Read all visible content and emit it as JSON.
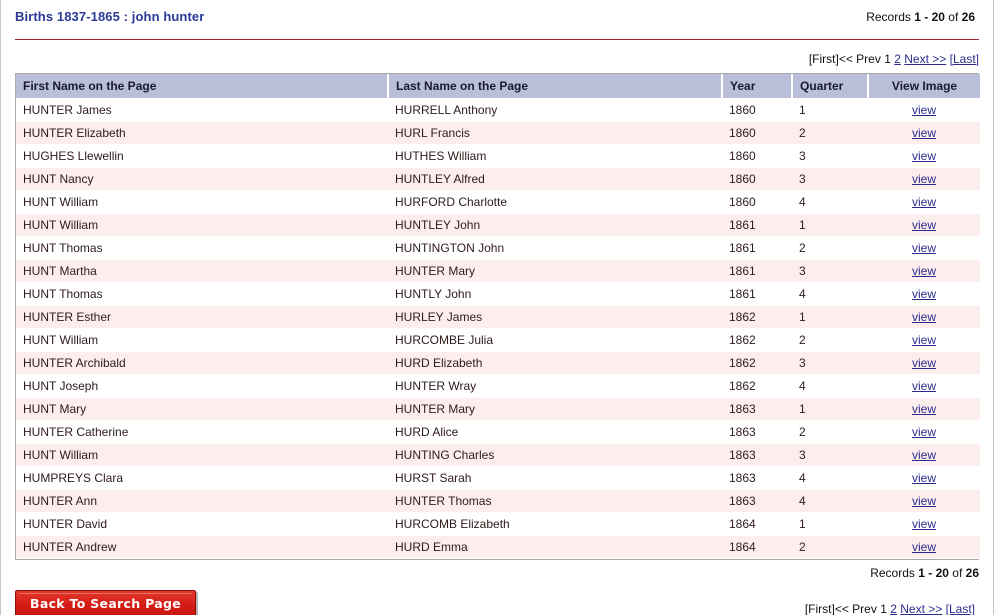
{
  "header": {
    "title": "Births 1837-1865 : john hunter",
    "records_prefix": "Records",
    "records_range": "1 - 20",
    "records_of": "of",
    "records_total": "26"
  },
  "pager": {
    "first": "[First]",
    "prev": "<< Prev",
    "page_current": "1",
    "page_next_num": "2",
    "next": "Next >>",
    "last": "[Last]"
  },
  "table": {
    "columns": [
      "First Name on the Page",
      "Last Name on the Page",
      "Year",
      "Quarter",
      "View Image"
    ],
    "view_link_label": "view",
    "rows": [
      {
        "first": "HUNTER James",
        "last": "HURRELL Anthony",
        "year": "1860",
        "quarter": "1",
        "view": "view"
      },
      {
        "first": "HUNTER Elizabeth",
        "last": "HURL Francis",
        "year": "1860",
        "quarter": "2",
        "view": "view"
      },
      {
        "first": "HUGHES Llewellin",
        "last": "HUTHES William",
        "year": "1860",
        "quarter": "3",
        "view": "view"
      },
      {
        "first": "HUNT Nancy",
        "last": "HUNTLEY Alfred",
        "year": "1860",
        "quarter": "3",
        "view": "view"
      },
      {
        "first": "HUNT William",
        "last": "HURFORD Charlotte",
        "year": "1860",
        "quarter": "4",
        "view": "view"
      },
      {
        "first": "HUNT William",
        "last": "HUNTLEY John",
        "year": "1861",
        "quarter": "1",
        "view": "view"
      },
      {
        "first": "HUNT Thomas",
        "last": "HUNTINGTON John",
        "year": "1861",
        "quarter": "2",
        "view": "view"
      },
      {
        "first": "HUNT Martha",
        "last": "HUNTER Mary",
        "year": "1861",
        "quarter": "3",
        "view": "view"
      },
      {
        "first": "HUNT Thomas",
        "last": "HUNTLY John",
        "year": "1861",
        "quarter": "4",
        "view": "view"
      },
      {
        "first": "HUNTER Esther",
        "last": "HURLEY James",
        "year": "1862",
        "quarter": "1",
        "view": "view"
      },
      {
        "first": "HUNT William",
        "last": "HURCOMBE Julia",
        "year": "1862",
        "quarter": "2",
        "view": "view"
      },
      {
        "first": "HUNTER Archibald",
        "last": "HURD Elizabeth",
        "year": "1862",
        "quarter": "3",
        "view": "view"
      },
      {
        "first": "HUNT Joseph",
        "last": "HUNTER Wray",
        "year": "1862",
        "quarter": "4",
        "view": "view"
      },
      {
        "first": "HUNT Mary",
        "last": "HUNTER Mary",
        "year": "1863",
        "quarter": "1",
        "view": "view"
      },
      {
        "first": "HUNTER Catherine",
        "last": "HURD Alice",
        "year": "1863",
        "quarter": "2",
        "view": "view"
      },
      {
        "first": "HUNT William",
        "last": "HUNTING Charles",
        "year": "1863",
        "quarter": "3",
        "view": "view"
      },
      {
        "first": "HUMPREYS Clara",
        "last": "HURST Sarah",
        "year": "1863",
        "quarter": "4",
        "view": "view"
      },
      {
        "first": "HUNTER Ann",
        "last": "HUNTER Thomas",
        "year": "1863",
        "quarter": "4",
        "view": "view"
      },
      {
        "first": "HUNTER David",
        "last": "HURCOMB Elizabeth",
        "year": "1864",
        "quarter": "1",
        "view": "view"
      },
      {
        "first": "HUNTER Andrew",
        "last": "HURD Emma",
        "year": "1864",
        "quarter": "2",
        "view": "view"
      }
    ]
  },
  "footer": {
    "records_prefix": "Records",
    "records_range": "1 - 20",
    "records_of": "of",
    "records_total": "26",
    "back_button": "Back To Search Page"
  },
  "colors": {
    "title_blue": "#2a3a96",
    "rule_red": "#a32a2a",
    "header_bg": "#b9bfd8",
    "row_alt": "#fdeeee",
    "link": "#2b2b8f",
    "button_red": "#d51c17"
  }
}
